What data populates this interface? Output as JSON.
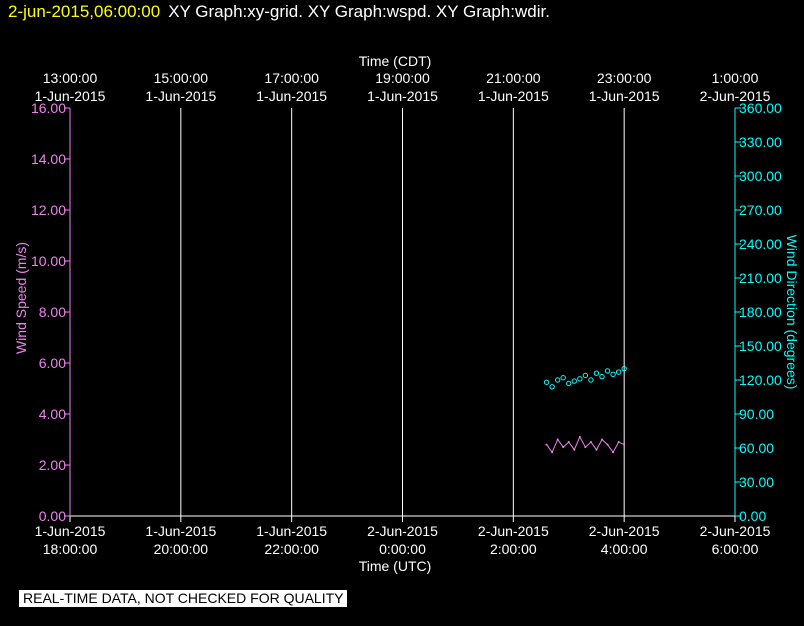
{
  "header": {
    "timestamp": "2-jun-2015,06:00:00",
    "titles": "XY Graph:xy-grid.  XY Graph:wspd.  XY Graph:wdir."
  },
  "footer": {
    "note": "REAL-TIME DATA, NOT CHECKED FOR QUALITY"
  },
  "colors": {
    "background": "#000000",
    "grid": "#ffffff",
    "wind_speed": "#ee82ee",
    "wind_direction": "#00ffff",
    "header_timestamp": "#ffff00"
  },
  "chart_data": {
    "type": "line",
    "top_axis": {
      "title": "Time (CDT)",
      "ticks": [
        {
          "time": "13:00:00",
          "date": "1-Jun-2015"
        },
        {
          "time": "15:00:00",
          "date": "1-Jun-2015"
        },
        {
          "time": "17:00:00",
          "date": "1-Jun-2015"
        },
        {
          "time": "19:00:00",
          "date": "1-Jun-2015"
        },
        {
          "time": "21:00:00",
          "date": "1-Jun-2015"
        },
        {
          "time": "23:00:00",
          "date": "1-Jun-2015"
        },
        {
          "time": "1:00:00",
          "date": "2-Jun-2015"
        }
      ]
    },
    "bottom_axis": {
      "title": "Time (UTC)",
      "ticks": [
        {
          "date": "1-Jun-2015",
          "time": "18:00:00"
        },
        {
          "date": "1-Jun-2015",
          "time": "20:00:00"
        },
        {
          "date": "1-Jun-2015",
          "time": "22:00:00"
        },
        {
          "date": "2-Jun-2015",
          "time": "0:00:00"
        },
        {
          "date": "2-Jun-2015",
          "time": "2:00:00"
        },
        {
          "date": "2-Jun-2015",
          "time": "4:00:00"
        },
        {
          "date": "2-Jun-2015",
          "time": "6:00:00"
        }
      ],
      "range": [
        "2015-06-01T18:00:00Z",
        "2015-06-02T06:00:00Z"
      ]
    },
    "left_axis": {
      "title": "Wind Speed (m/s)",
      "ylim": [
        0,
        16
      ],
      "tick_labels": [
        "0.00",
        "2.00",
        "4.00",
        "6.00",
        "8.00",
        "10.00",
        "12.00",
        "14.00",
        "16.00"
      ]
    },
    "right_axis": {
      "title": "Wind Direction (degrees)",
      "ylim": [
        0,
        360
      ],
      "tick_labels": [
        "0.00",
        "30.00",
        "60.00",
        "90.00",
        "120.00",
        "150.00",
        "180.00",
        "210.00",
        "240.00",
        "270.00",
        "300.00",
        "330.00",
        "360.00"
      ]
    },
    "grid": "vertical lines at labeled time ticks",
    "series": [
      {
        "name": "Wind Speed",
        "axis": "left",
        "style": "line",
        "x": [
          "2015-06-02T02:36:00Z",
          "2015-06-02T02:42:00Z",
          "2015-06-02T02:48:00Z",
          "2015-06-02T02:54:00Z",
          "2015-06-02T03:00:00Z",
          "2015-06-02T03:06:00Z",
          "2015-06-02T03:12:00Z",
          "2015-06-02T03:18:00Z",
          "2015-06-02T03:24:00Z",
          "2015-06-02T03:30:00Z",
          "2015-06-02T03:36:00Z",
          "2015-06-02T03:42:00Z",
          "2015-06-02T03:48:00Z",
          "2015-06-02T03:54:00Z",
          "2015-06-02T04:00:00Z"
        ],
        "y": [
          2.8,
          2.5,
          3.0,
          2.7,
          2.9,
          2.6,
          3.1,
          2.7,
          2.9,
          2.6,
          3.0,
          2.8,
          2.5,
          2.9,
          2.8
        ]
      },
      {
        "name": "Wind Direction",
        "axis": "right",
        "style": "scatter",
        "x": [
          "2015-06-02T02:36:00Z",
          "2015-06-02T02:42:00Z",
          "2015-06-02T02:48:00Z",
          "2015-06-02T02:54:00Z",
          "2015-06-02T03:00:00Z",
          "2015-06-02T03:06:00Z",
          "2015-06-02T03:12:00Z",
          "2015-06-02T03:18:00Z",
          "2015-06-02T03:24:00Z",
          "2015-06-02T03:30:00Z",
          "2015-06-02T03:36:00Z",
          "2015-06-02T03:42:00Z",
          "2015-06-02T03:48:00Z",
          "2015-06-02T03:54:00Z",
          "2015-06-02T04:00:00Z"
        ],
        "y": [
          118,
          114,
          120,
          122,
          117,
          119,
          121,
          124,
          120,
          126,
          123,
          128,
          125,
          127,
          130
        ]
      }
    ]
  }
}
